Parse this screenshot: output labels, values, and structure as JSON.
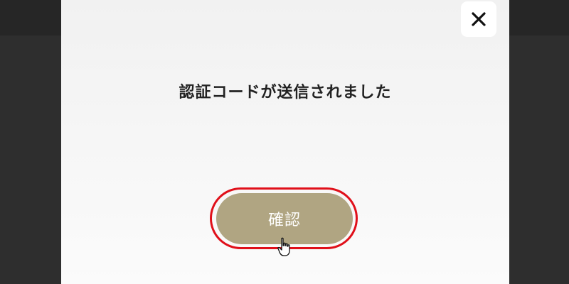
{
  "dialog": {
    "message": "認証コードが送信されました",
    "confirm_label": "確認",
    "close_icon": "close-icon"
  },
  "colors": {
    "button": "#b0a582",
    "highlight": "#e0101a",
    "backdrop": "#2c2c2c"
  }
}
